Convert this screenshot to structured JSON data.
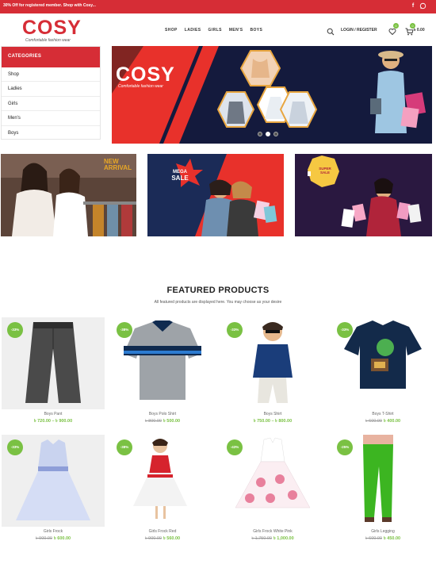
{
  "topbar": {
    "promo": "30% Off for registered member. Shop with Cosy...",
    "facebook_icon": "facebook-icon",
    "whatsapp_icon": "whatsapp-icon",
    "color": "#d62d36"
  },
  "header": {
    "logo_text": "COSY",
    "logo_tagline": "Comfortable fashion wear",
    "nav": [
      "SHOP",
      "LADIES",
      "GIRLS",
      "MEN'S",
      "BOYS"
    ],
    "account": "LOGIN / REGISTER",
    "wishlist_count": "0",
    "cart_count": "0",
    "cart_total": "৳ 0.00"
  },
  "categories": {
    "title": "CATEGORIES",
    "items": [
      "Shop",
      "Ladies",
      "Girls",
      "Men's",
      "Boys"
    ]
  },
  "hero": {
    "logo_text": "COSY",
    "tagline": "Comfortable fashion wear",
    "slides": 3,
    "active_slide": 2
  },
  "banners": [
    {
      "badge": "NEW ARRIVAL"
    },
    {
      "badge_line1": "MEGA",
      "badge_line2": "SALE"
    },
    {
      "badge": "SUPER SALE"
    }
  ],
  "featured": {
    "title": "FEATURED PRODUCTS",
    "subtitle": "All featured products are displayed here. You may choose as your desire",
    "products": [
      {
        "name": "Boys Pant",
        "sale": "-33%",
        "old_price": "",
        "price": "৳ 720.00 – ৳ 900.00"
      },
      {
        "name": "Boys Polo Shirt",
        "sale": "-38%",
        "old_price": "৳ 800.00",
        "price": "৳ 500.00"
      },
      {
        "name": "Boys Shirt",
        "sale": "-33%",
        "old_price": "",
        "price": "৳ 750.00 – ৳ 800.00"
      },
      {
        "name": "Boys T-Shirt",
        "sale": "-33%",
        "old_price": "৳ 600.00",
        "price": "৳ 400.00"
      },
      {
        "name": "Girls Frock",
        "sale": "-33%",
        "old_price": "৳ 900.00",
        "price": "৳ 600.00"
      },
      {
        "name": "Girls Frock Red",
        "sale": "-38%",
        "old_price": "৳ 900.00",
        "price": "৳ 560.00"
      },
      {
        "name": "Girls Frock White Pink",
        "sale": "-43%",
        "old_price": "৳ 1,750.00",
        "price": "৳ 1,000.00"
      },
      {
        "name": "Girls Legging",
        "sale": "-25%",
        "old_price": "৳ 600.00",
        "price": "৳ 450.00"
      }
    ]
  },
  "colors": {
    "brand_red": "#d62d36",
    "sale_green": "#7ac143"
  }
}
